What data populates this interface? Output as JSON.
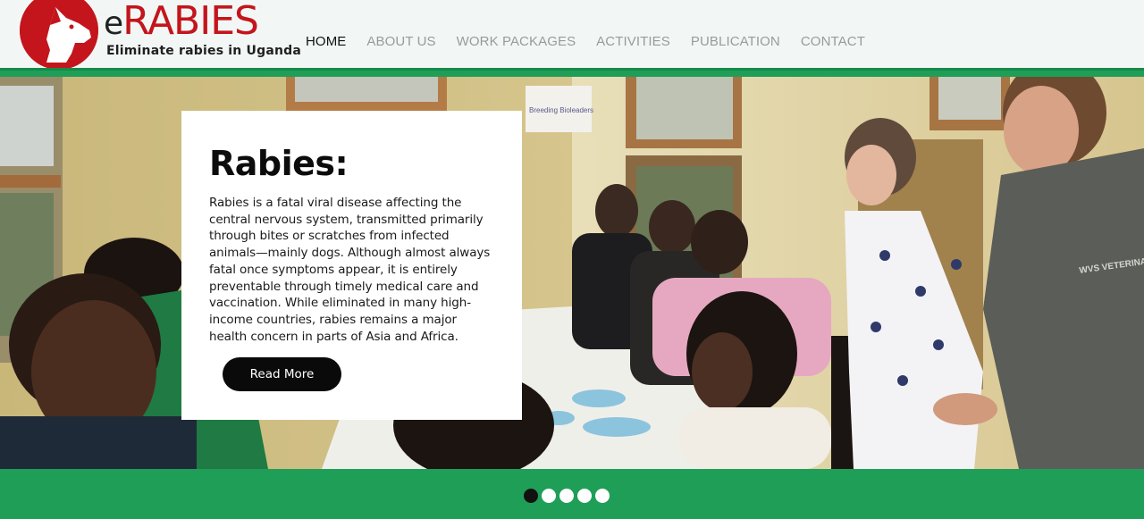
{
  "brand": {
    "logo_prefix": "e",
    "logo_name": "RABIES",
    "tagline": "Eliminate rabies in Uganda",
    "red": "#c4151c",
    "green": "#1f9e57"
  },
  "nav": {
    "items": [
      {
        "label": "HOME",
        "active": true
      },
      {
        "label": "ABOUT US",
        "active": false
      },
      {
        "label": "WORK PACKAGES",
        "active": false
      },
      {
        "label": "ACTIVITIES",
        "active": false
      },
      {
        "label": "PUBLICATION",
        "active": false
      },
      {
        "label": "CONTACT",
        "active": false
      }
    ]
  },
  "hero": {
    "image": "workshop-photo",
    "card": {
      "title": "Rabies:",
      "body": "Rabies is a fatal viral disease affecting the central nervous system, transmitted primarily through bites or scratches from infected animals—mainly dogs. Although almost always fatal once symptoms appear, it is entirely preventable through timely medical care and vaccination. While eliminated in many high-income countries, rabies remains a major health concern in parts of Asia and Africa.",
      "button_label": "Read More"
    },
    "photo_texts": {
      "sign": "Breeding Bioleaders",
      "shirt": "WVS VETERINARY TASKFORCE"
    }
  },
  "carousel": {
    "slide_count": 5,
    "active_index": 0
  }
}
